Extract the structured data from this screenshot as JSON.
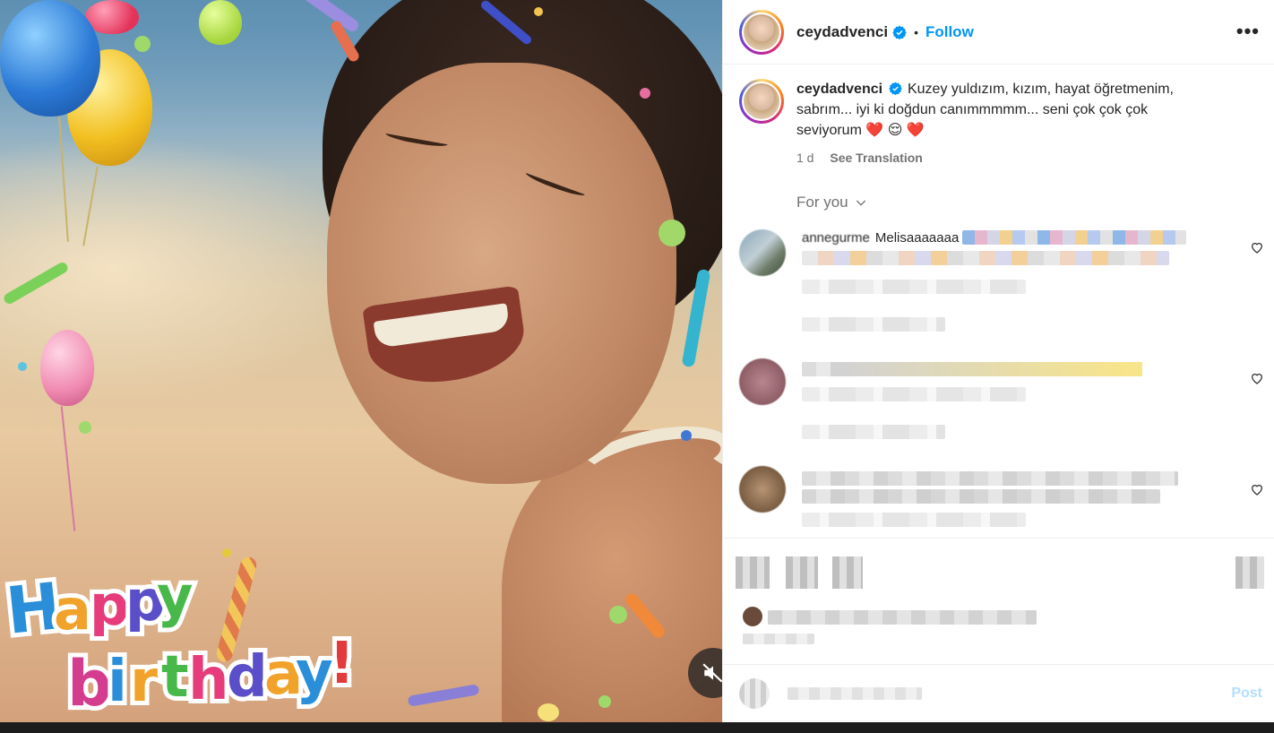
{
  "header": {
    "username": "ceydadvenci",
    "separator": "•",
    "follow_label": "Follow",
    "more_label": "•••"
  },
  "caption": {
    "username": "ceydadvenci",
    "text": "Kuzey yuldızım, kızım, hayat öğretmenim, sabrım... iyi ki doğdun canımmmmm... seni çok çok çok seviyorum ❤️ 😌 ❤️",
    "time": "1 d",
    "see_translation": "See Translation"
  },
  "comments_filter": {
    "label": "For you"
  },
  "comments": [
    {
      "username": "annegurme",
      "text": "Melisaaaaaaa"
    }
  ],
  "add_comment": {
    "post_label": "Post"
  },
  "media": {
    "overlay_text": "happy birthday!"
  },
  "colors": {
    "accent": "#0095f6",
    "verified": "#0095f6",
    "text": "#262626",
    "muted": "#737373",
    "like_red": "#ed4956"
  },
  "icons": {
    "verified": "verified-badge-icon",
    "more": "more-options-icon",
    "chevron": "chevron-down-icon",
    "heart": "heart-icon",
    "mute": "audio-muted-icon"
  }
}
